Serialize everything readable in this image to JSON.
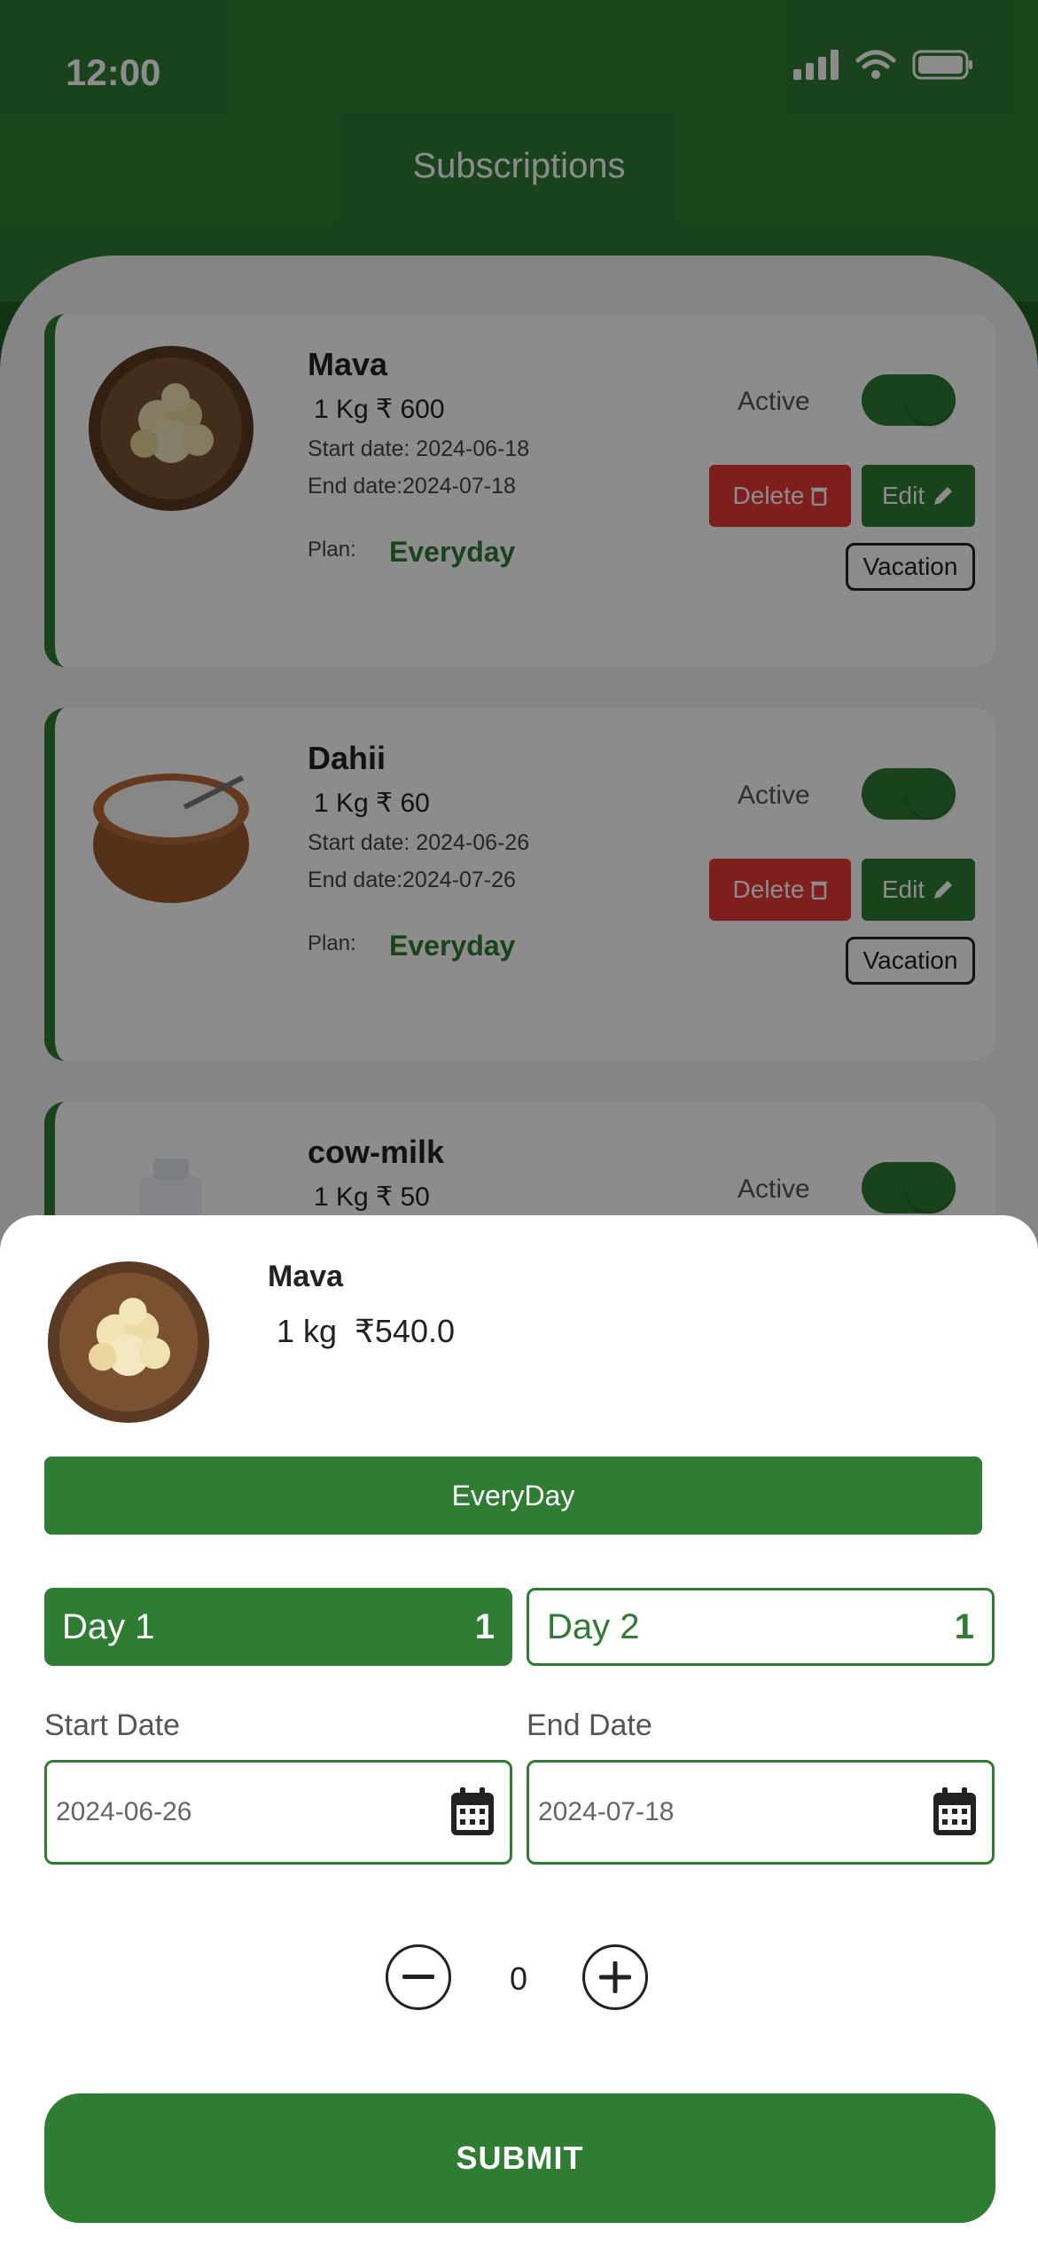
{
  "status_bar": {
    "time": "12:00"
  },
  "header": {
    "title": "Subscriptions"
  },
  "subscriptions": [
    {
      "name": "Mava",
      "qty": "1 Kg ₹ 600",
      "start": "Start date: 2024-06-18",
      "end": "End date:2024-07-18",
      "plan_label": "Plan:",
      "plan": "Everyday",
      "status": "Active",
      "delete_label": "Delete",
      "edit_label": "Edit",
      "vacation_label": "Vacation",
      "image": "mava"
    },
    {
      "name": "Dahii",
      "qty": "1 Kg ₹ 60",
      "start": "Start date: 2024-06-26",
      "end": "End date:2024-07-26",
      "plan_label": "Plan:",
      "plan": "Everyday",
      "status": "Active",
      "delete_label": "Delete",
      "edit_label": "Edit",
      "vacation_label": "Vacation",
      "image": "dahi"
    },
    {
      "name": "cow-milk",
      "qty": "1 Kg ₹ 50",
      "status": "Active",
      "image": "milk"
    }
  ],
  "sheet": {
    "product_name": "Mava",
    "qty": "1 kg",
    "price": "₹540.0",
    "plan_button": "EveryDay",
    "days": [
      {
        "label": "Day 1",
        "count": "1"
      },
      {
        "label": "Day 2",
        "count": "1"
      }
    ],
    "start_date_label": "Start Date",
    "start_date_value": "2024-06-26",
    "end_date_label": "End Date",
    "end_date_value": "2024-07-18",
    "quantity": "0",
    "submit_label": "SUBMIT"
  },
  "colors": {
    "brand": "#2e7d32",
    "delete": "#e53935"
  }
}
